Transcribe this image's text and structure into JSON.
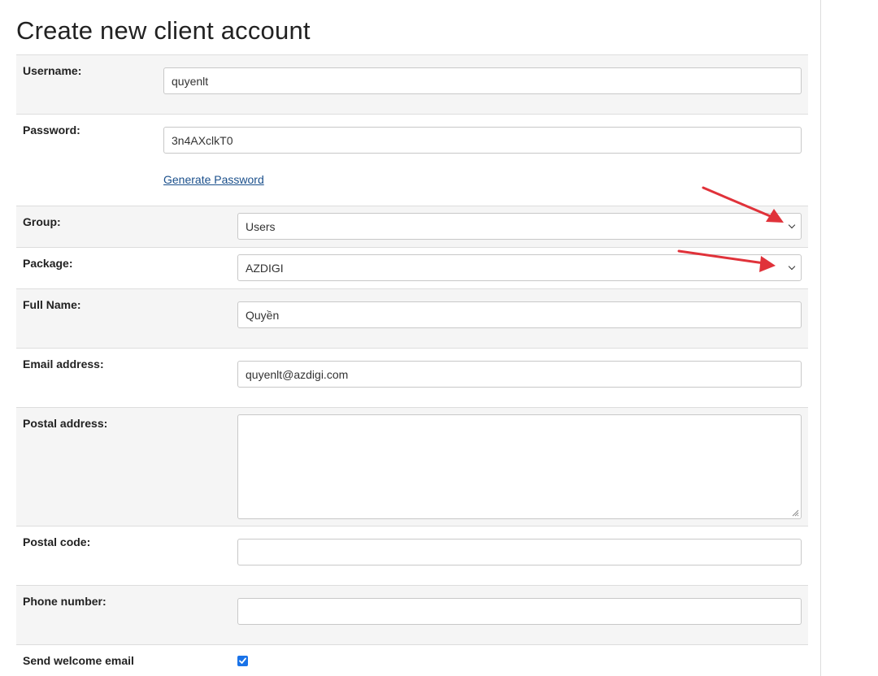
{
  "page": {
    "title": "Create new client account"
  },
  "form": {
    "username": {
      "label": "Username:",
      "value": "quyenlt"
    },
    "password": {
      "label": "Password:",
      "value": "3n4AXclkT0",
      "generate_link": "Generate Password"
    },
    "group": {
      "label": "Group:",
      "selected": "Users"
    },
    "package": {
      "label": "Package:",
      "selected": "AZDIGI"
    },
    "full_name": {
      "label": "Full Name:",
      "value": "Quyền"
    },
    "email": {
      "label": "Email address:",
      "value": "quyenlt@azdigi.com"
    },
    "postal_address": {
      "label": "Postal address:",
      "value": ""
    },
    "postal_code": {
      "label": "Postal code:",
      "value": ""
    },
    "phone": {
      "label": "Phone number:",
      "value": ""
    },
    "welcome_email": {
      "label": "Send welcome email",
      "checked": true
    }
  },
  "colors": {
    "accent": "#1a73e8",
    "annotation_arrow": "#e0323a",
    "link": "#1a4f8b"
  },
  "icons": {
    "select_arrow": "chevron-down-icon",
    "checkbox_mark": "check-icon",
    "resize": "resize-grip-icon",
    "annotation": "red-arrow-icon"
  }
}
